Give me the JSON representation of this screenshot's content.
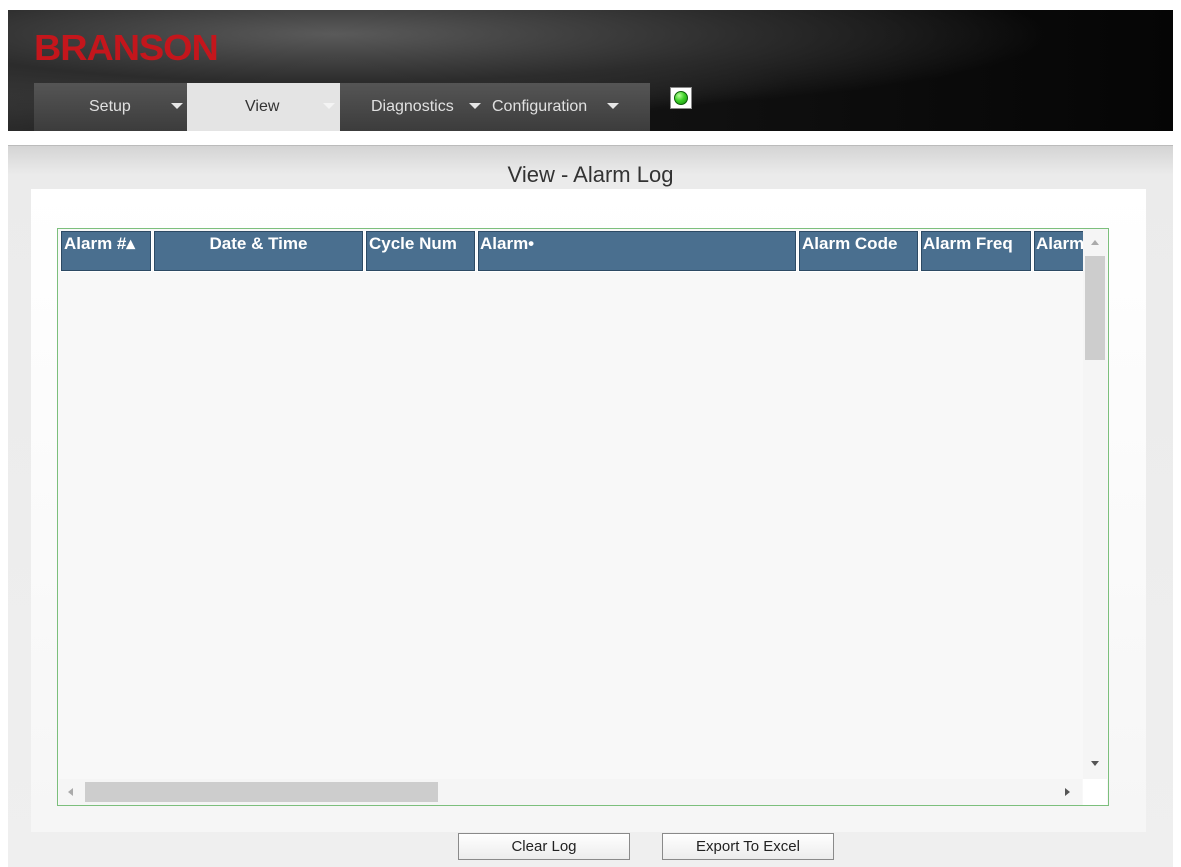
{
  "header": {
    "logo_text": "BRANSON",
    "logo_color": "#c4161c",
    "nav": [
      {
        "label": "Setup",
        "active": false
      },
      {
        "label": "View",
        "active": true
      },
      {
        "label": "Diagnostics",
        "active": false
      },
      {
        "label": "Configuration",
        "active": false
      }
    ],
    "status_indicator": {
      "icon": "green-led-icon",
      "color": "#3fd22a"
    }
  },
  "main": {
    "title": "View - Alarm Log",
    "table": {
      "columns": [
        "Alarm #▴",
        "Date & Time",
        "Cycle Num",
        "Alarm•",
        "Alarm Code",
        "Alarm Freq",
        "Alarm"
      ],
      "header_color": "#4a6f8f",
      "rows": []
    },
    "buttons": {
      "clear_log": "Clear Log",
      "export": "Export To Excel"
    }
  }
}
